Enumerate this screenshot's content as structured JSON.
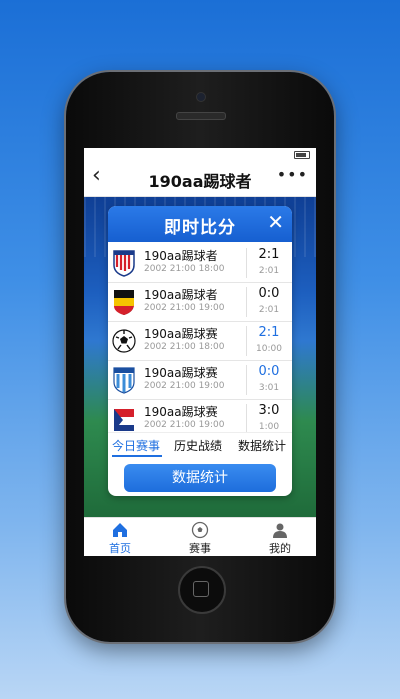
{
  "app": {
    "title": "190aa踢球者"
  },
  "panel": {
    "title": "即时比分",
    "matches": [
      {
        "team": "190aa踢球者",
        "time": "2002 21:00    18:00",
        "score": "2:1",
        "half": "2:01",
        "crest": "stripes-red"
      },
      {
        "team": "190aa踢球者",
        "time": "2002 21:00    19:00",
        "score": "0:0",
        "half": "2:01",
        "crest": "belgium"
      },
      {
        "team": "190aa踢球赛",
        "time": "2002 21:00    18:00",
        "score": "2:1",
        "half": "10:00",
        "crest": "ball"
      },
      {
        "team": "190aa踢球赛",
        "time": "2002 21:00    19:00",
        "score": "0:0",
        "half": "3:01",
        "crest": "stripes-blue"
      },
      {
        "team": "190aa踢球赛",
        "time": "2002 21:00    19:00",
        "score": "3:0",
        "half": "1:00",
        "crest": "flag-red-blue"
      }
    ],
    "tabs": [
      "今日赛事",
      "历史战绩",
      "数据统计"
    ],
    "active_tab": "今日赛事",
    "stats_button": "数据统计"
  },
  "bottom_nav": [
    {
      "label": "首页",
      "icon": "home-icon",
      "active": true
    },
    {
      "label": "赛事",
      "icon": "ball-icon",
      "active": false
    },
    {
      "label": "我的",
      "icon": "user-icon",
      "active": false
    }
  ],
  "colors": {
    "accent": "#1f6fe0",
    "background": "#3f8fe6"
  }
}
